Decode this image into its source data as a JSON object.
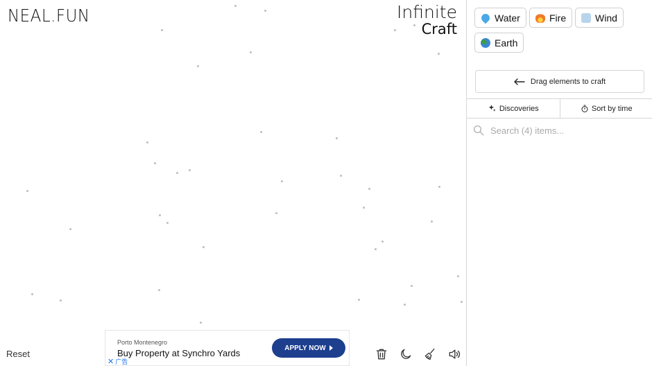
{
  "header": {
    "logo": "NEAL.FUN",
    "title_line1": "Infinite",
    "title_line2": "Craft"
  },
  "canvas": {
    "reset_label": "Reset"
  },
  "ad": {
    "brand": "Porto Montenegro",
    "headline": "Buy Property at Synchro Yards",
    "cta_label": "APPLY NOW",
    "ad_label": "广告"
  },
  "toolbar": {
    "tools": [
      "trash-icon",
      "moon-icon",
      "broom-icon",
      "speaker-icon"
    ]
  },
  "sidebar": {
    "items": [
      {
        "emoji": "droplet-icon",
        "label": "Water",
        "color": "#4aa8e8"
      },
      {
        "emoji": "fire-icon",
        "label": "Fire",
        "color": "#f2792a"
      },
      {
        "emoji": "wind-icon",
        "label": "Wind",
        "color": "#b8d4ec"
      },
      {
        "emoji": "globe-icon",
        "label": "Earth",
        "color": "#3f9a4a"
      }
    ],
    "drag_hint": "Drag elements to craft",
    "tabs": {
      "discoveries": "Discoveries",
      "sort": "Sort by time"
    },
    "search_placeholder": "Search (4) items..."
  },
  "colors": {
    "accent": "#1d3f8e",
    "border": "#d6d6d6",
    "dot": "#bdbdbd"
  }
}
